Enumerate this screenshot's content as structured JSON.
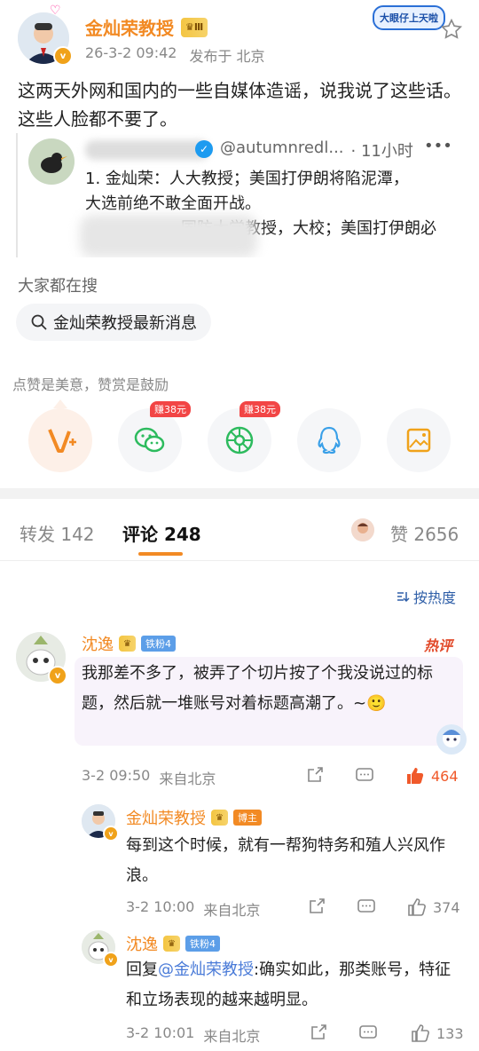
{
  "post": {
    "author": "金灿荣教授",
    "level_badge": "Ⅲ",
    "time": "26-3-2 09:42",
    "location": "发布于 北京",
    "sticker": "大眼仔上天啦",
    "text": "这两天外网和国内的一些自媒体造谣，说我说了这些话。这些人脸都不要了。"
  },
  "quoted": {
    "handle": "@autumnredl...",
    "time": "· 11小时",
    "line1": "1. 金灿荣：人大教授；美国打伊朗将陷泥潭，",
    "line2": "大选前绝不敢全面开战。",
    "line3": "国防大学教授，大校；美国打伊朗必"
  },
  "search": {
    "heading": "大家都在搜",
    "chip": "金灿荣教授最新消息"
  },
  "reward": {
    "caption": "点赞是美意，赞赏是鼓励",
    "earn1": "赚38元",
    "earn2": "赚38元"
  },
  "tabs": {
    "repost": "转发 142",
    "comments": "评论 248",
    "likes": "赞 2656"
  },
  "sort": "按热度",
  "comments": [
    {
      "author": "沈逸",
      "badge": "铁粉4",
      "hot": "热评",
      "text": "我那差不多了，被弄了个切片按了个我没说过的标题，然后就一堆账号对着标题高潮了。~🙂",
      "time": "3-2 09:50",
      "loc": "来自北京",
      "likes": "464"
    },
    {
      "author": "金灿荣教授",
      "badge": "博主",
      "text": "每到这个时候，就有一帮狗特务和殖人兴风作浪。",
      "time": "3-2 10:00",
      "loc": "来自北京",
      "likes": "374"
    },
    {
      "author": "沈逸",
      "badge": "铁粉4",
      "reply_prefix": "回复",
      "mention": "@金灿荣教授",
      "text": ":确实如此，那类账号，特征和立场表现的越来越明显。",
      "time": "3-2 10:01",
      "loc": "来自北京",
      "likes": "133"
    }
  ],
  "colors": {
    "brand_orange": "#f28a24",
    "accent_gold": "#f4c542",
    "link_blue": "#4a7bd8",
    "like_red": "#f0592a"
  }
}
